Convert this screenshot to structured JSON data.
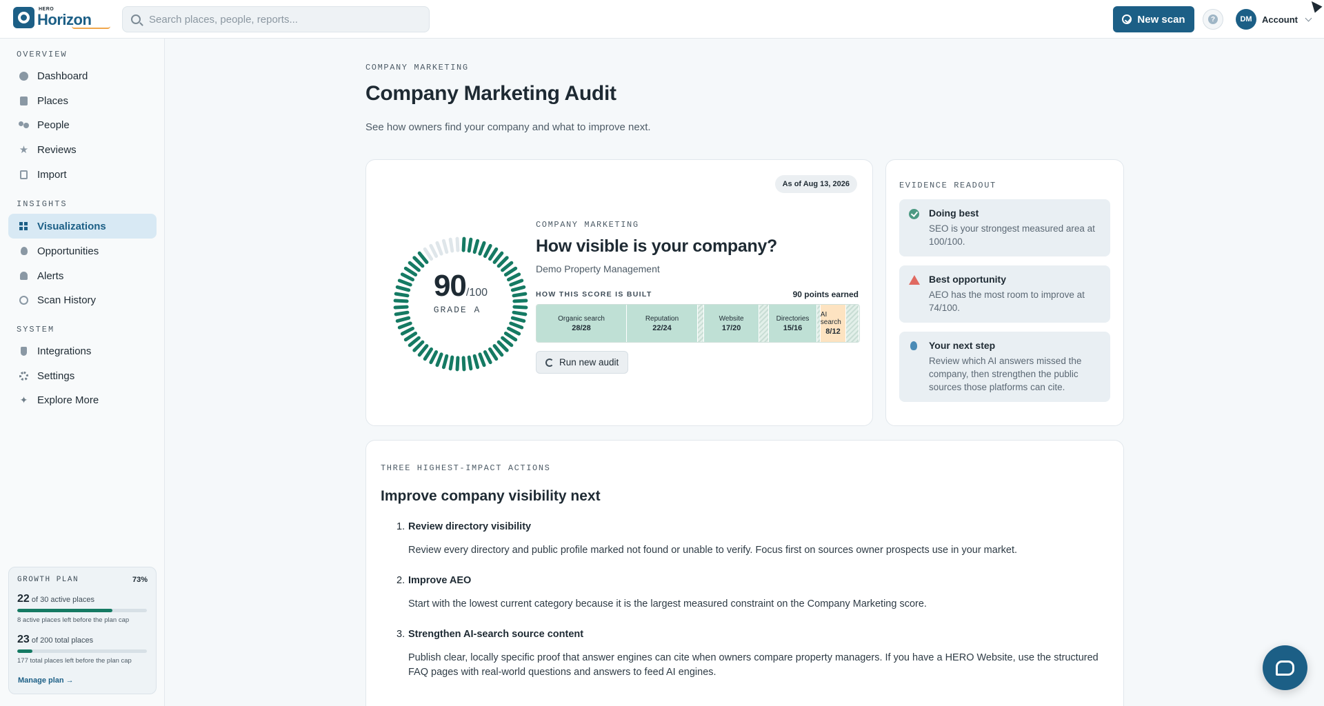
{
  "app": {
    "logo_small": "HERO",
    "logo_name": "Horizon",
    "search_placeholder": "Search places, people, reports...",
    "new_scan_label": "New scan",
    "help_label": "?",
    "avatar_initials": "DM",
    "account_label": "Account"
  },
  "sidebar": {
    "sections": [
      "OVERVIEW",
      "INSIGHTS",
      "SYSTEM"
    ],
    "items": [
      {
        "label": "Dashboard",
        "icon": "dashboard-icon"
      },
      {
        "label": "Places",
        "icon": "building-icon"
      },
      {
        "label": "People",
        "icon": "people-icon"
      },
      {
        "label": "Reviews",
        "icon": "star-icon"
      },
      {
        "label": "Import",
        "icon": "import-icon"
      },
      {
        "label": "Visualizations",
        "icon": "grid-icon",
        "active": true
      },
      {
        "label": "Opportunities",
        "icon": "lightbulb-icon"
      },
      {
        "label": "Alerts",
        "icon": "bell-icon"
      },
      {
        "label": "Scan History",
        "icon": "history-icon"
      },
      {
        "label": "Integrations",
        "icon": "plug-icon"
      },
      {
        "label": "Settings",
        "icon": "gear-icon"
      },
      {
        "label": "Explore More",
        "icon": "sparkle-icon"
      }
    ],
    "growth_plan": {
      "title": "GROWTH PLAN",
      "percent": "73%",
      "active_count": "22",
      "active_suffix": "of 30 active places",
      "active_fraction": 0.733,
      "active_note": "8 active places left before the plan cap",
      "total_count": "23",
      "total_suffix": "of 200 total places",
      "total_fraction": 0.115,
      "total_note": "177 total places left before the plan cap",
      "manage_label": "Manage plan →"
    }
  },
  "page": {
    "eyebrow": "COMPANY MARKETING",
    "title": "Company Marketing Audit",
    "subtitle": "See how owners find your company and what to improve next."
  },
  "score_card": {
    "as_of": "As of Aug 13, 2026",
    "score": "90",
    "score_max": "/100",
    "score_fraction": 0.9,
    "grade": "GRADE A",
    "eyebrow": "COMPANY MARKETING",
    "question": "How visible is your company?",
    "company": "Demo Property Management",
    "built_label": "HOW THIS SCORE IS BUILT",
    "points_earned": "90 points earned",
    "segments": [
      {
        "label": "Organic search",
        "value": "28/28",
        "earned": 28,
        "max": 28,
        "tone": "green"
      },
      {
        "label": "Reputation",
        "value": "22/24",
        "earned": 22,
        "max": 24,
        "tone": "green"
      },
      {
        "label": "Website",
        "value": "17/20",
        "earned": 17,
        "max": 20,
        "tone": "green"
      },
      {
        "label": "Directories",
        "value": "15/16",
        "earned": 15,
        "max": 16,
        "tone": "green"
      },
      {
        "label": "AI search",
        "value": "8/12",
        "earned": 8,
        "max": 12,
        "tone": "amber"
      }
    ],
    "run_audit_label": "Run new audit"
  },
  "evidence": {
    "title": "EVIDENCE READOUT",
    "items": [
      {
        "head": "Doing best",
        "text": "SEO is your strongest measured area at 100/100.",
        "icon": "check-circle-icon"
      },
      {
        "head": "Best opportunity",
        "text": "AEO has the most room to improve at 74/100.",
        "icon": "warning-icon"
      },
      {
        "head": "Your next step",
        "text": "Review which AI answers missed the company, then strengthen the public sources those platforms can cite.",
        "icon": "lightbulb-icon"
      }
    ]
  },
  "actions": {
    "eyebrow": "THREE HIGHEST-IMPACT ACTIONS",
    "title": "Improve company visibility next",
    "items": [
      {
        "num": "1.",
        "title": "Review directory visibility",
        "text": "Review every directory and public profile marked not found or unable to verify. Focus first on sources owner prospects use in your market."
      },
      {
        "num": "2.",
        "title": "Improve AEO",
        "text": "Start with the lowest current category because it is the largest measured constraint on the Company Marketing score."
      },
      {
        "num": "3.",
        "title": "Strengthen AI-search source content",
        "text": "Publish clear, locally specific proof that answer engines can cite when owners compare property managers. If you have a HERO Website, use the structured FAQ pages with real-world questions and answers to feed AI engines."
      }
    ]
  },
  "colors": {
    "brand": "#1c5f86",
    "gauge_filled": "#157a63",
    "gauge_empty": "#dfe6ea",
    "segment_green": "#bfe0d5",
    "segment_amber": "#fde3c1"
  }
}
